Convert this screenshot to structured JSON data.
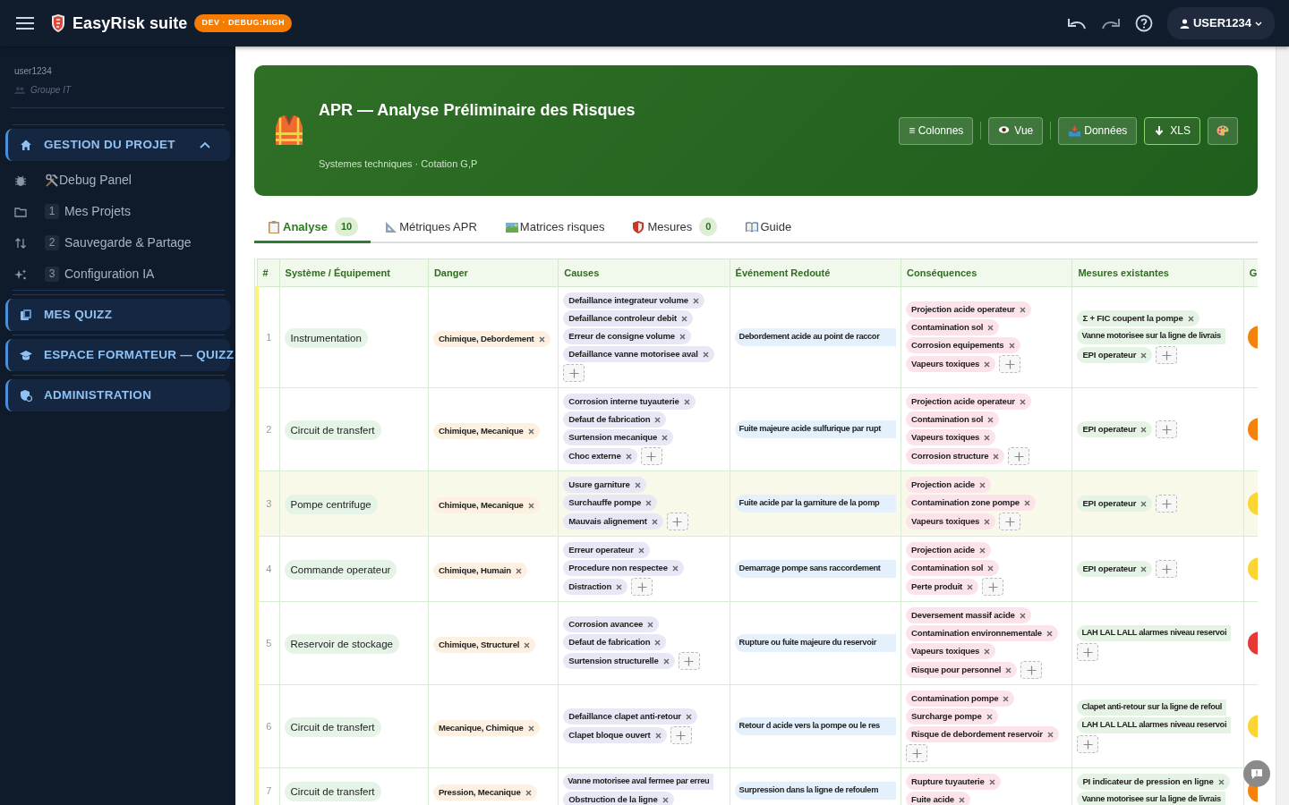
{
  "navbar": {
    "brand": "EasyRisk suite",
    "env_badge": "DEV · DEBUG:HIGH",
    "user": "USER1234"
  },
  "sidebar": {
    "username": "user1234",
    "group": "Groupe IT",
    "sections": [
      {
        "label": "GESTION DU PROJET",
        "expanded": true,
        "items": [
          {
            "label": "Debug Panel"
          },
          {
            "number": "1",
            "label": "Mes Projets"
          },
          {
            "number": "2",
            "label": "Sauvegarde & Partage"
          },
          {
            "number": "3",
            "label": "Configuration IA"
          }
        ]
      },
      {
        "label": "MES QUIZZ",
        "expanded": false
      },
      {
        "label": "ESPACE FORMATEUR — QUIZZ",
        "expanded": false
      },
      {
        "label": "ADMINISTRATION",
        "expanded": false
      }
    ]
  },
  "header": {
    "title": "APR — Analyse Préliminaire des Risques",
    "subtitle": "Systemes techniques · Cotation G,P",
    "buttons": [
      "≡ Colonnes",
      "Vue",
      "Données",
      "XLS"
    ]
  },
  "tabs": [
    {
      "label": "Analyse",
      "count": "10",
      "selected": true
    },
    {
      "label": "Métriques APR",
      "selected": false
    },
    {
      "label": "Matrices risques",
      "selected": false
    },
    {
      "label": "Mesures",
      "count": "0",
      "selected": false
    },
    {
      "label": "Guide",
      "selected": false
    }
  ],
  "table": {
    "columns": [
      "#",
      "Système / Équipement",
      "Danger",
      "Causes",
      "Événement Redouté",
      "Conséquences",
      "Mesures existantes",
      "G"
    ],
    "rows": [
      {
        "number": "1",
        "system": "Instrumentation",
        "danger": "Chimique, Debordement",
        "highlighted": false,
        "partial": false,
        "color": "#f5820d",
        "event": "Debordement acide au point de raccor",
        "causes": [
          {
            "text": "Defaillance integrateur volume",
            "removable": true
          },
          {
            "text": "Defaillance controleur debit",
            "removable": true
          },
          {
            "text": "Erreur de consigne volume",
            "removable": true
          },
          {
            "text": "Defaillance vanne motorisee aval",
            "removable": true
          }
        ],
        "consequences": [
          {
            "text": "Projection acide operateur",
            "removable": true
          },
          {
            "text": "Contamination sol",
            "removable": true
          },
          {
            "text": "Corrosion equipements",
            "removable": true
          },
          {
            "text": "Vapeurs toxiques",
            "removable": true
          }
        ],
        "measures": [
          {
            "text": "Σ + FIC coupent la pompe",
            "removable": true
          },
          {
            "text": "Vanne motorisee sur la ligne de livrais",
            "removable": false
          },
          {
            "text": "EPI operateur",
            "removable": true
          }
        ]
      },
      {
        "number": "2",
        "system": "Circuit de transfert",
        "danger": "Chimique, Mecanique",
        "highlighted": false,
        "partial": false,
        "color": "#f5820d",
        "event": "Fuite majeure acide sulfurique par rupt",
        "causes": [
          {
            "text": "Corrosion interne tuyauterie",
            "removable": true
          },
          {
            "text": "Defaut de fabrication",
            "removable": true
          },
          {
            "text": "Surtension mecanique",
            "removable": true
          },
          {
            "text": "Choc externe",
            "removable": true
          }
        ],
        "consequences": [
          {
            "text": "Projection acide operateur",
            "removable": true
          },
          {
            "text": "Contamination sol",
            "removable": true
          },
          {
            "text": "Vapeurs toxiques",
            "removable": true
          },
          {
            "text": "Corrosion structure",
            "removable": true
          }
        ],
        "measures": [
          {
            "text": "EPI operateur",
            "removable": true
          }
        ]
      },
      {
        "number": "3",
        "system": "Pompe centrifuge",
        "danger": "Chimique, Mecanique",
        "highlighted": true,
        "partial": false,
        "color": "#fbd535",
        "event": "Fuite acide par la garniture de la pomp",
        "causes": [
          {
            "text": "Usure garniture",
            "removable": true
          },
          {
            "text": "Surchauffe pompe",
            "removable": true
          },
          {
            "text": "Mauvais alignement",
            "removable": true
          }
        ],
        "consequences": [
          {
            "text": "Projection acide",
            "removable": true
          },
          {
            "text": "Contamination zone pompe",
            "removable": true
          },
          {
            "text": "Vapeurs toxiques",
            "removable": true
          }
        ],
        "measures": [
          {
            "text": "EPI operateur",
            "removable": true
          }
        ]
      },
      {
        "number": "4",
        "system": "Commande operateur",
        "danger": "Chimique, Humain",
        "highlighted": false,
        "partial": false,
        "color": "#fbd535",
        "event": "Demarrage pompe sans raccordement",
        "causes": [
          {
            "text": "Erreur operateur",
            "removable": true
          },
          {
            "text": "Procedure non respectee",
            "removable": true
          },
          {
            "text": "Distraction",
            "removable": true
          }
        ],
        "consequences": [
          {
            "text": "Projection acide",
            "removable": true
          },
          {
            "text": "Contamination sol",
            "removable": true
          },
          {
            "text": "Perte produit",
            "removable": true
          }
        ],
        "measures": [
          {
            "text": "EPI operateur",
            "removable": true
          }
        ]
      },
      {
        "number": "5",
        "system": "Reservoir de stockage",
        "danger": "Chimique, Structurel",
        "highlighted": false,
        "partial": false,
        "color": "#e53935",
        "event": "Rupture ou fuite majeure du reservoir",
        "causes": [
          {
            "text": "Corrosion avancee",
            "removable": true
          },
          {
            "text": "Defaut de fabrication",
            "removable": true
          },
          {
            "text": "Surtension structurelle",
            "removable": true
          }
        ],
        "consequences": [
          {
            "text": "Deversement massif acide",
            "removable": true
          },
          {
            "text": "Contamination environnementale",
            "removable": true
          },
          {
            "text": "Vapeurs toxiques",
            "removable": true
          },
          {
            "text": "Risque pour personnel",
            "removable": true
          }
        ],
        "measures": [
          {
            "text": "LAH LAL LALL alarmes niveau reservoi",
            "removable": false
          }
        ]
      },
      {
        "number": "6",
        "system": "Circuit de transfert",
        "danger": "Mecanique, Chimique",
        "highlighted": false,
        "partial": false,
        "color": "#fbd535",
        "event": "Retour d acide vers la pompe ou le res",
        "causes": [
          {
            "text": "Defaillance clapet anti-retour",
            "removable": true
          },
          {
            "text": "Clapet bloque ouvert",
            "removable": true
          }
        ],
        "consequences": [
          {
            "text": "Contamination pompe",
            "removable": true
          },
          {
            "text": "Surcharge pompe",
            "removable": true
          },
          {
            "text": "Risque de debordement reservoir",
            "removable": true
          }
        ],
        "measures": [
          {
            "text": "Clapet anti-retour sur la ligne de refoul",
            "removable": false
          },
          {
            "text": "LAH LAL LALL alarmes niveau reservoi",
            "removable": false
          }
        ]
      },
      {
        "number": "7",
        "system": "Circuit de transfert",
        "danger": "Pression, Mecanique",
        "highlighted": false,
        "partial": true,
        "color": "#f5820d",
        "event": "Surpression dans la ligne de refoulem",
        "causes": [
          {
            "text": "Vanne motorisee aval fermee par erreu",
            "removable": false
          },
          {
            "text": "Obstruction de la ligne",
            "removable": true
          }
        ],
        "consequences": [
          {
            "text": "Rupture tuyauterie",
            "removable": true
          },
          {
            "text": "Fuite acide",
            "removable": true
          }
        ],
        "measures": [
          {
            "text": "PI indicateur de pression en ligne",
            "removable": true
          },
          {
            "text": "Vanne motorisee sur la ligne de livrais",
            "removable": false
          }
        ]
      }
    ]
  }
}
